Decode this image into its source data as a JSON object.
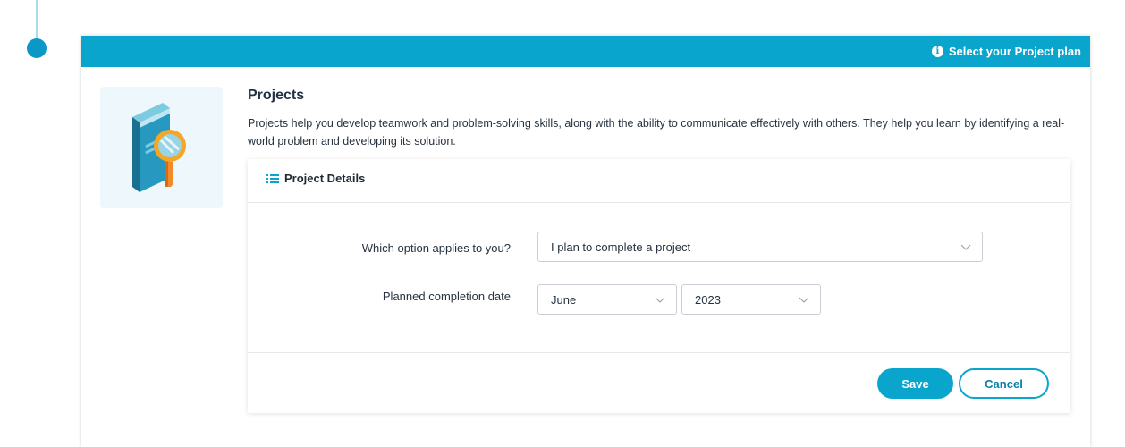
{
  "header": {
    "info_icon": "info-circle-icon",
    "plan_label": "Select your Project plan"
  },
  "section": {
    "title": "Projects",
    "description": "Projects help you develop teamwork and problem-solving skills, along with the ability to communicate effectively with others. They help you learn by identifying a real-world problem and developing its solution.",
    "illustration_icon": "book-magnifier-icon"
  },
  "details": {
    "title": "Project Details",
    "title_icon": "list-icon",
    "option_label": "Which option applies to you?",
    "option_value": "I plan to complete a project",
    "date_label": "Planned completion date",
    "month_value": "June",
    "year_value": "2023"
  },
  "actions": {
    "save_label": "Save",
    "cancel_label": "Cancel"
  },
  "colors": {
    "accent": "#0aa5cd",
    "timeline_dot": "#0c98c7"
  }
}
